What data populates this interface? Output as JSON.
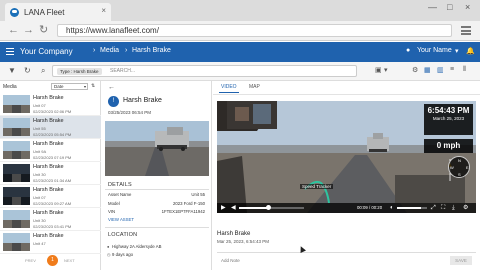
{
  "browser": {
    "tab_title": "LANA Fleet",
    "tab_close": "×",
    "url": "https://www.lanafleet.com/",
    "win_minimize": "—",
    "win_maximize": "□",
    "win_close": "×"
  },
  "header": {
    "company": "Your Company",
    "breadcrumb_media": "Media",
    "breadcrumb_event": "Harsh Brake",
    "user": "Your Name"
  },
  "toolbar": {
    "filter_chip": "Type : Harsh Brake",
    "search_placeholder": "SEARCH..."
  },
  "media_list": {
    "label": "Media",
    "sort_value": "Date",
    "items": [
      {
        "title": "Harsh Brake",
        "unit": "Unit 07",
        "date": "02/23/2023 02:06 PM",
        "dark": false
      },
      {
        "title": "Harsh Brake",
        "unit": "Unit 55",
        "date": "02/23/2023 05:54 PM",
        "dark": false
      },
      {
        "title": "Harsh Brake",
        "unit": "Unit 9A",
        "date": "02/23/2023 07:19 PM",
        "dark": false
      },
      {
        "title": "Harsh Brake",
        "unit": "Unit 30",
        "date": "02/23/2023 01:34 AM",
        "dark": true
      },
      {
        "title": "Harsh Brake",
        "unit": "Unit 07",
        "date": "02/23/2023 09:27 AM",
        "dark": true
      },
      {
        "title": "Harsh Brake",
        "unit": "Unit 30",
        "date": "02/23/2023 03:41 PM",
        "dark": false
      },
      {
        "title": "Harsh Brake",
        "unit": "Unit 47",
        "date": "",
        "dark": false
      }
    ],
    "selected_index": 1,
    "prev": "PREV",
    "page": "1",
    "next": "NEXT"
  },
  "detail": {
    "title": "Harsh Brake",
    "datetime": "03/25/2023 06:54 PM",
    "details_header": "DETAILS",
    "rows": [
      {
        "key": "Asset Name",
        "value": "Unit 55"
      },
      {
        "key": "Model",
        "value": "2023 Ford F-150"
      },
      {
        "key": "VIN",
        "value": "1FTEX1EP7FFA11942"
      }
    ],
    "view_asset": "VIEW ASSET",
    "location_header": "LOCATION",
    "location": "Highway 2A Aldersyde AB",
    "ago": "9 days ago"
  },
  "video": {
    "tab_video": "VIDEO",
    "tab_map": "MAP",
    "time": "6:54:43 PM",
    "date": "March 25, 2023",
    "speed": "0 mph",
    "speed_tracker": "Speed Tracker",
    "compass_n": "N",
    "compass_s": "S",
    "compass_e": "E",
    "compass_w": "W",
    "elapsed": "00:09 / 00:20",
    "progress": 0.45,
    "volume": 0.8,
    "title": "Harsh Brake",
    "datetime": "Mar 25, 2023, 6:54:43 PM",
    "note_placeholder": "Add Note",
    "note_button": "SAVE"
  }
}
